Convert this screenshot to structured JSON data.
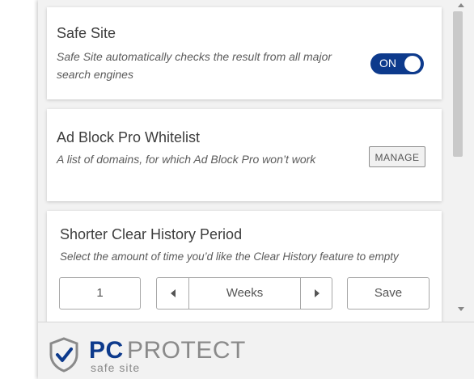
{
  "safe_site": {
    "title": "Safe Site",
    "description": "Safe Site automatically checks the result from all major search engines",
    "toggle_label": "ON"
  },
  "whitelist": {
    "title": "Ad Block Pro Whitelist",
    "description": "A list of domains, for which Ad Block Pro won’t work",
    "manage_label": "MANAGE"
  },
  "clear_history": {
    "title": "Shorter Clear History Period",
    "description": "Select the amount of time you’d like the Clear History feature to empty",
    "amount_value": "1",
    "unit_value": "Weeks",
    "save_label": "Save"
  },
  "footer": {
    "brand_pc": "PC",
    "brand_protect": "PROTECT",
    "brand_sub": "safe site"
  },
  "colors": {
    "accent": "#0d3a8c",
    "panel_bg": "#f2f2f2"
  },
  "icons": {
    "logo": "shield-check-icon",
    "unit_prev": "triangle-left-icon",
    "unit_next": "triangle-right-icon",
    "scroll_up": "scroll-up-arrow-icon",
    "scroll_down": "scroll-down-arrow-icon"
  }
}
